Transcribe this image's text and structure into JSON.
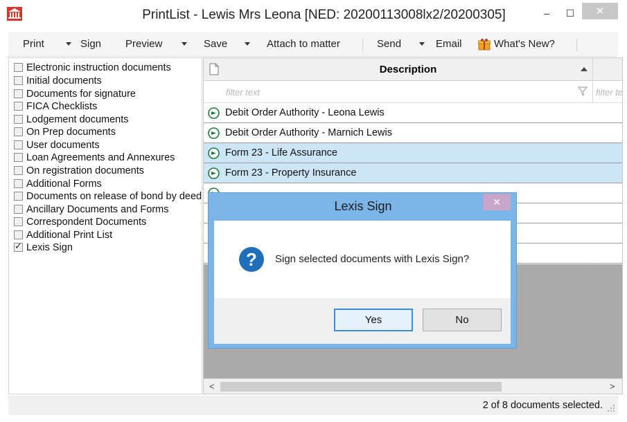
{
  "window": {
    "title": "PrintList - Lewis Mrs Leona [NED: 20200113008lx2/20200305]",
    "minimize": "–",
    "maximize": "☐",
    "close": "✕",
    "app_icon": "bank-icon"
  },
  "toolbar": {
    "print": "Print",
    "sign": "Sign",
    "preview": "Preview",
    "save": "Save",
    "attach": "Attach to matter",
    "send": "Send",
    "email": "Email",
    "whats_new": "What's New?",
    "whats_new_icon": "gift-icon"
  },
  "categories": [
    {
      "label": "Electronic instruction documents",
      "checked": false
    },
    {
      "label": "Initial documents",
      "checked": false
    },
    {
      "label": "Documents for signature",
      "checked": false
    },
    {
      "label": "FICA Checklists",
      "checked": false
    },
    {
      "label": "Lodgement documents",
      "checked": false
    },
    {
      "label": "On Prep documents",
      "checked": false
    },
    {
      "label": "User documents",
      "checked": false
    },
    {
      "label": "Loan Agreements and Annexures",
      "checked": false
    },
    {
      "label": "On registration documents",
      "checked": false
    },
    {
      "label": "Additional Forms",
      "checked": false
    },
    {
      "label": "Documents on release of bond by deed",
      "checked": false
    },
    {
      "label": "Ancillary Documents and Forms",
      "checked": false
    },
    {
      "label": "Correspondent Documents",
      "checked": false
    },
    {
      "label": "Additional Print List",
      "checked": false
    },
    {
      "label": "Lexis Sign",
      "checked": true
    }
  ],
  "grid": {
    "header": "Description",
    "filter_placeholder": "filter text",
    "filter_placeholder_2": "filter te",
    "rows": [
      {
        "label": "Debit Order Authority - Leona Lewis",
        "selected": false
      },
      {
        "label": "Debit Order Authority - Marnich Lewis",
        "selected": false
      },
      {
        "label": "Form 23 - Life Assurance",
        "selected": true
      },
      {
        "label": "Form 23 - Property Insurance",
        "selected": true
      },
      {
        "label": "",
        "selected": false
      },
      {
        "label": "",
        "selected": false
      },
      {
        "label": "",
        "selected": false
      },
      {
        "label": "",
        "selected": false
      }
    ],
    "scroll_left": "<",
    "scroll_right": ">"
  },
  "status": {
    "text": "2 of 8 documents selected."
  },
  "dialog": {
    "title": "Lexis Sign",
    "close": "✕",
    "message": "Sign selected documents with Lexis Sign?",
    "yes": "Yes",
    "no": "No",
    "icon": "question-icon",
    "accent": "#1f6fb8"
  }
}
